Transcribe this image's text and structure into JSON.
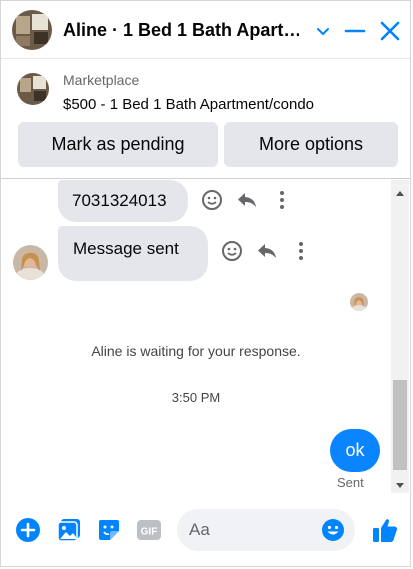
{
  "header": {
    "title": "Aline · 1 Bed 1 Bath Apart…"
  },
  "marketplace": {
    "label": "Marketplace",
    "listing": "$500 - 1 Bed 1 Bath Apartment/condo",
    "pending_label": "Mark as pending",
    "options_label": "More options"
  },
  "messages": {
    "phone_text": "7031324013",
    "sent_text": "Message sent",
    "waiting_text": "Aline is waiting for your response.",
    "timestamp": "3:50 PM",
    "out_text": "ok",
    "out_status": "Sent"
  },
  "composer": {
    "placeholder": "Aa"
  },
  "colors": {
    "accent": "#0084ff",
    "bubble_in": "#e4e6eb",
    "bubble_out": "#0b84ff"
  },
  "icons": [
    "house-photo",
    "chevron-down-icon",
    "minimize-icon",
    "close-icon",
    "smiley-icon",
    "reply-icon",
    "more-vertical-icon",
    "plus-circle-icon",
    "image-icon",
    "sticker-icon",
    "gif-icon",
    "emoji-icon",
    "thumbs-up-icon"
  ]
}
